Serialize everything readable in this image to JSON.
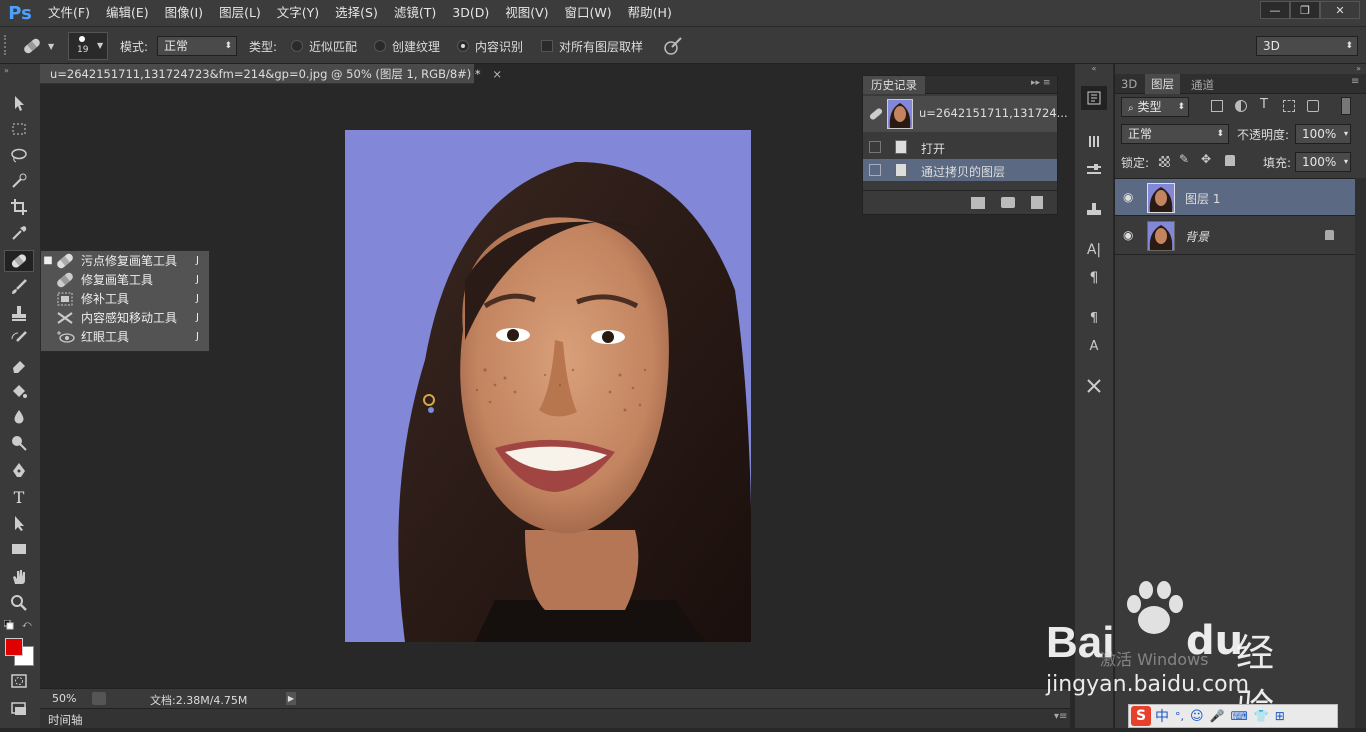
{
  "app": {
    "logo": "Ps"
  },
  "menu": [
    "文件(F)",
    "编辑(E)",
    "图像(I)",
    "图层(L)",
    "文字(Y)",
    "选择(S)",
    "滤镜(T)",
    "3D(D)",
    "视图(V)",
    "窗口(W)",
    "帮助(H)"
  ],
  "window_controls": {
    "minimize": "—",
    "restore": "❐",
    "close": "✕"
  },
  "options": {
    "brush_size": "19",
    "mode_label": "模式:",
    "mode_value": "正常",
    "type_label": "类型:",
    "radio_1": "近似匹配",
    "radio_2": "创建纹理",
    "radio_3": "内容识别",
    "radio_selected": "内容识别",
    "checkbox_label": "对所有图层取样",
    "workspace": "3D"
  },
  "document": {
    "tab_title": "u=2642151711,131724723&fm=214&gp=0.jpg @ 50% (图层 1, RGB/8#) *",
    "tab_close": "×",
    "zoom": "50%",
    "doc_info": "文档:2.38M/4.75M",
    "timeline": "时间轴"
  },
  "tool_flyout": {
    "items": [
      {
        "label": "污点修复画笔工具",
        "key": "J",
        "active": true
      },
      {
        "label": "修复画笔工具",
        "key": "J",
        "active": false
      },
      {
        "label": "修补工具",
        "key": "J",
        "active": false
      },
      {
        "label": "内容感知移动工具",
        "key": "J",
        "active": false
      },
      {
        "label": "红眼工具",
        "key": "J",
        "active": false
      }
    ]
  },
  "history": {
    "title": "历史记录",
    "snapshot": "u=2642151711,131724...",
    "steps": [
      "打开",
      "通过拷贝的图层"
    ]
  },
  "layers_panel": {
    "tabs": [
      "3D",
      "图层",
      "通道"
    ],
    "active_tab": "图层",
    "filter_kind": "类型",
    "blend_mode": "正常",
    "opacity_label": "不透明度:",
    "opacity": "100%",
    "lock_label": "锁定:",
    "fill_label": "填充:",
    "fill": "100%",
    "layers": [
      {
        "name": "图层 1",
        "selected": true,
        "locked": false
      },
      {
        "name": "背景",
        "selected": false,
        "locked": true
      }
    ]
  },
  "watermark": {
    "brand": "Bai",
    "brand2": "du",
    "suffix": "经验",
    "url": "jingyan.baidu.com",
    "activate": "激活 Windows"
  },
  "tray": {
    "ime": "中",
    "items": [
      "°,",
      "☺",
      "🎤",
      "⌨",
      "👕",
      "⊞"
    ]
  },
  "colors": {
    "foreground": "#e00000",
    "background": "#ffffff",
    "ps_blue": "#4ea0ff",
    "photo_bg": "#8287d8"
  }
}
